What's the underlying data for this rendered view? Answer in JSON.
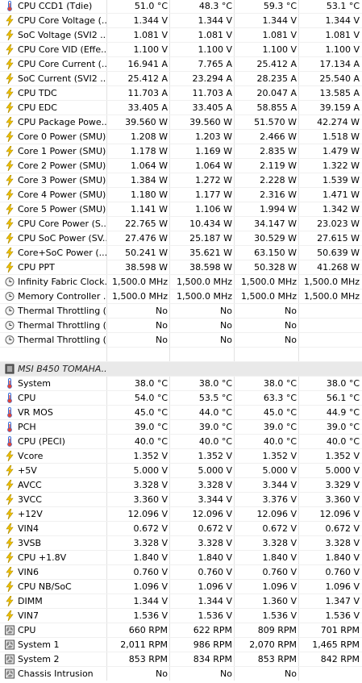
{
  "rows": [
    {
      "kind": "temp",
      "label": "CPU CCD1 (Tdie)",
      "v": [
        "51.0 °C",
        "48.3 °C",
        "59.3 °C",
        "53.1 °C"
      ]
    },
    {
      "kind": "volt",
      "label": "CPU Core Voltage (...",
      "v": [
        "1.344 V",
        "1.344 V",
        "1.344 V",
        "1.344 V"
      ]
    },
    {
      "kind": "volt",
      "label": "SoC Voltage (SVI2 ...",
      "v": [
        "1.081 V",
        "1.081 V",
        "1.081 V",
        "1.081 V"
      ]
    },
    {
      "kind": "volt",
      "label": "CPU Core VID (Effe...",
      "v": [
        "1.100 V",
        "1.100 V",
        "1.100 V",
        "1.100 V"
      ]
    },
    {
      "kind": "volt",
      "label": "CPU Core Current (...",
      "v": [
        "16.941 A",
        "7.765 A",
        "25.412 A",
        "17.134 A"
      ]
    },
    {
      "kind": "volt",
      "label": "SoC Current (SVI2 ...",
      "v": [
        "25.412 A",
        "23.294 A",
        "28.235 A",
        "25.540 A"
      ]
    },
    {
      "kind": "volt",
      "label": "CPU TDC",
      "v": [
        "11.703 A",
        "11.703 A",
        "20.047 A",
        "13.585 A"
      ]
    },
    {
      "kind": "volt",
      "label": "CPU EDC",
      "v": [
        "33.405 A",
        "33.405 A",
        "58.855 A",
        "39.159 A"
      ]
    },
    {
      "kind": "volt",
      "label": "CPU Package Powe...",
      "v": [
        "39.560 W",
        "39.560 W",
        "51.570 W",
        "42.274 W"
      ]
    },
    {
      "kind": "volt",
      "label": "Core 0 Power (SMU)",
      "v": [
        "1.208 W",
        "1.203 W",
        "2.466 W",
        "1.518 W"
      ]
    },
    {
      "kind": "volt",
      "label": "Core 1 Power (SMU)",
      "v": [
        "1.178 W",
        "1.169 W",
        "2.835 W",
        "1.479 W"
      ]
    },
    {
      "kind": "volt",
      "label": "Core 2 Power (SMU)",
      "v": [
        "1.064 W",
        "1.064 W",
        "2.119 W",
        "1.322 W"
      ]
    },
    {
      "kind": "volt",
      "label": "Core 3 Power (SMU)",
      "v": [
        "1.384 W",
        "1.272 W",
        "2.228 W",
        "1.539 W"
      ]
    },
    {
      "kind": "volt",
      "label": "Core 4 Power (SMU)",
      "v": [
        "1.180 W",
        "1.177 W",
        "2.316 W",
        "1.471 W"
      ]
    },
    {
      "kind": "volt",
      "label": "Core 5 Power (SMU)",
      "v": [
        "1.141 W",
        "1.106 W",
        "1.994 W",
        "1.342 W"
      ]
    },
    {
      "kind": "volt",
      "label": "CPU Core Power (S...",
      "v": [
        "22.765 W",
        "10.434 W",
        "34.147 W",
        "23.023 W"
      ]
    },
    {
      "kind": "volt",
      "label": "CPU SoC Power (SV...",
      "v": [
        "27.476 W",
        "25.187 W",
        "30.529 W",
        "27.615 W"
      ]
    },
    {
      "kind": "volt",
      "label": "Core+SoC Power (...",
      "v": [
        "50.241 W",
        "35.621 W",
        "63.150 W",
        "50.639 W"
      ]
    },
    {
      "kind": "volt",
      "label": "CPU PPT",
      "v": [
        "38.598 W",
        "38.598 W",
        "50.328 W",
        "41.268 W"
      ]
    },
    {
      "kind": "clock",
      "label": "Infinity Fabric Clock...",
      "v": [
        "1,500.0 MHz",
        "1,500.0 MHz",
        "1,500.0 MHz",
        "1,500.0 MHz"
      ]
    },
    {
      "kind": "clock",
      "label": "Memory Controller ...",
      "v": [
        "1,500.0 MHz",
        "1,500.0 MHz",
        "1,500.0 MHz",
        "1,500.0 MHz"
      ]
    },
    {
      "kind": "clock",
      "label": "Thermal Throttling (...",
      "v": [
        "No",
        "No",
        "No",
        ""
      ]
    },
    {
      "kind": "clock",
      "label": "Thermal Throttling (...",
      "v": [
        "No",
        "No",
        "No",
        ""
      ]
    },
    {
      "kind": "clock",
      "label": "Thermal Throttling (...",
      "v": [
        "No",
        "No",
        "No",
        ""
      ]
    },
    {
      "kind": "blank",
      "label": "",
      "v": [
        "",
        "",
        "",
        ""
      ]
    },
    {
      "kind": "header",
      "label": "MSI B450 TOMAHA...",
      "v": [
        "",
        "",
        "",
        ""
      ]
    },
    {
      "kind": "temp",
      "label": "System",
      "v": [
        "38.0 °C",
        "38.0 °C",
        "38.0 °C",
        "38.0 °C"
      ]
    },
    {
      "kind": "temp",
      "label": "CPU",
      "v": [
        "54.0 °C",
        "53.5 °C",
        "63.3 °C",
        "56.1 °C"
      ]
    },
    {
      "kind": "temp",
      "label": "VR MOS",
      "v": [
        "45.0 °C",
        "44.0 °C",
        "45.0 °C",
        "44.9 °C"
      ]
    },
    {
      "kind": "temp",
      "label": "PCH",
      "v": [
        "39.0 °C",
        "39.0 °C",
        "39.0 °C",
        "39.0 °C"
      ]
    },
    {
      "kind": "temp",
      "label": "CPU (PECI)",
      "v": [
        "40.0 °C",
        "40.0 °C",
        "40.0 °C",
        "40.0 °C"
      ]
    },
    {
      "kind": "volt",
      "label": "Vcore",
      "v": [
        "1.352 V",
        "1.352 V",
        "1.352 V",
        "1.352 V"
      ]
    },
    {
      "kind": "volt",
      "label": "+5V",
      "v": [
        "5.000 V",
        "5.000 V",
        "5.000 V",
        "5.000 V"
      ]
    },
    {
      "kind": "volt",
      "label": "AVCC",
      "v": [
        "3.328 V",
        "3.328 V",
        "3.344 V",
        "3.329 V"
      ]
    },
    {
      "kind": "volt",
      "label": "3VCC",
      "v": [
        "3.360 V",
        "3.344 V",
        "3.376 V",
        "3.360 V"
      ]
    },
    {
      "kind": "volt",
      "label": "+12V",
      "v": [
        "12.096 V",
        "12.096 V",
        "12.096 V",
        "12.096 V"
      ]
    },
    {
      "kind": "volt",
      "label": "VIN4",
      "v": [
        "0.672 V",
        "0.672 V",
        "0.672 V",
        "0.672 V"
      ]
    },
    {
      "kind": "volt",
      "label": "3VSB",
      "v": [
        "3.328 V",
        "3.328 V",
        "3.328 V",
        "3.328 V"
      ]
    },
    {
      "kind": "volt",
      "label": "CPU +1.8V",
      "v": [
        "1.840 V",
        "1.840 V",
        "1.840 V",
        "1.840 V"
      ]
    },
    {
      "kind": "volt",
      "label": "VIN6",
      "v": [
        "0.760 V",
        "0.760 V",
        "0.760 V",
        "0.760 V"
      ]
    },
    {
      "kind": "volt",
      "label": "CPU NB/SoC",
      "v": [
        "1.096 V",
        "1.096 V",
        "1.096 V",
        "1.096 V"
      ]
    },
    {
      "kind": "volt",
      "label": "DIMM",
      "v": [
        "1.344 V",
        "1.344 V",
        "1.360 V",
        "1.347 V"
      ]
    },
    {
      "kind": "volt",
      "label": "VIN7",
      "v": [
        "1.536 V",
        "1.536 V",
        "1.536 V",
        "1.536 V"
      ]
    },
    {
      "kind": "fan",
      "label": "CPU",
      "v": [
        "660 RPM",
        "622 RPM",
        "809 RPM",
        "701 RPM"
      ]
    },
    {
      "kind": "fan",
      "label": "System 1",
      "v": [
        "2,011 RPM",
        "986 RPM",
        "2,070 RPM",
        "1,465 RPM"
      ]
    },
    {
      "kind": "fan",
      "label": "System 2",
      "v": [
        "853 RPM",
        "834 RPM",
        "853 RPM",
        "842 RPM"
      ]
    },
    {
      "kind": "fan",
      "label": "Chassis Intrusion",
      "v": [
        "No",
        "No",
        "No",
        ""
      ]
    }
  ],
  "icons": {
    "temp": "thermometer-icon",
    "volt": "lightning-bolt-icon",
    "clock": "clock-icon",
    "fan": "fan-icon",
    "header": "motherboard-icon"
  },
  "colors": {
    "bolt": "#f2c200",
    "thermo": "#3a6fd8",
    "thermo_bulb": "#e0463a",
    "fan": "#555555",
    "grid": "#e2e2e2"
  }
}
